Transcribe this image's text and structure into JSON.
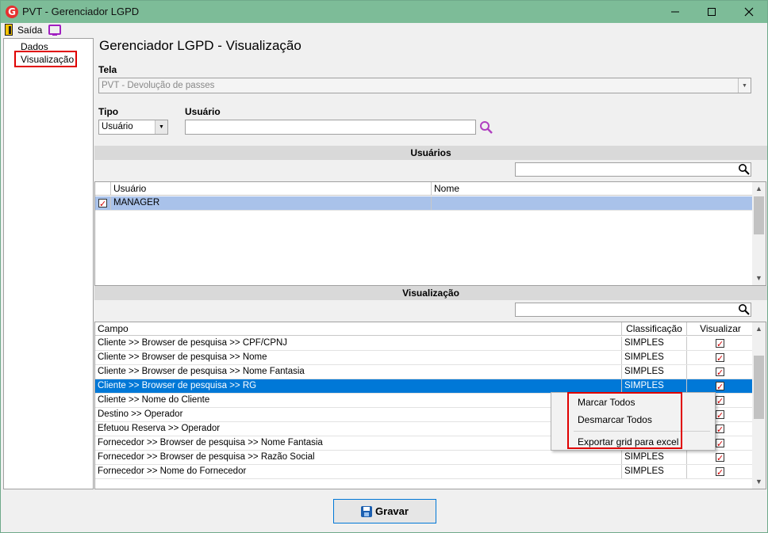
{
  "window": {
    "title": "PVT - Gerenciador LGPD",
    "app_icon_letter": "G"
  },
  "menu": {
    "exit_label": "Saída"
  },
  "tree": {
    "items": [
      {
        "label": "Dados"
      },
      {
        "label": "Visualização"
      }
    ]
  },
  "page": {
    "title": "Gerenciador LGPD - Visualização"
  },
  "form": {
    "tela_label": "Tela",
    "tela_value": "PVT - Devolução de passes",
    "tipo_label": "Tipo",
    "tipo_value": "Usuário",
    "usuario_label": "Usuário",
    "usuario_value": ""
  },
  "usuarios_section": {
    "title": "Usuários",
    "search_value": "",
    "columns": [
      "Usuário",
      "Nome"
    ],
    "rows": [
      {
        "checked": true,
        "usuario": "MANAGER",
        "nome": ""
      }
    ]
  },
  "visualizacao_section": {
    "title": "Visualização",
    "search_value": "",
    "columns": [
      "Campo",
      "Classificação",
      "Visualizar"
    ],
    "rows": [
      {
        "campo": "Cliente >> Browser de pesquisa >> CPF/CPNJ",
        "classificacao": "SIMPLES",
        "visualizar": true
      },
      {
        "campo": "Cliente >> Browser de pesquisa >> Nome",
        "classificacao": "SIMPLES",
        "visualizar": true
      },
      {
        "campo": "Cliente >> Browser de pesquisa >> Nome Fantasia",
        "classificacao": "SIMPLES",
        "visualizar": true
      },
      {
        "campo": "Cliente >> Browser de pesquisa >> RG",
        "classificacao": "SIMPLES",
        "visualizar": true,
        "selected": true
      },
      {
        "campo": "Cliente >> Nome do Cliente",
        "classificacao": "",
        "visualizar": true
      },
      {
        "campo": "Destino >> Operador",
        "classificacao": "",
        "visualizar": true
      },
      {
        "campo": "Efetuou Reserva >> Operador",
        "classificacao": "",
        "visualizar": true
      },
      {
        "campo": "Fornecedor >> Browser de pesquisa >> Nome Fantasia",
        "classificacao": "",
        "visualizar": true
      },
      {
        "campo": "Fornecedor >> Browser de pesquisa >> Razão Social",
        "classificacao": "SIMPLES",
        "visualizar": true
      },
      {
        "campo": "Fornecedor >> Nome do Fornecedor",
        "classificacao": "SIMPLES",
        "visualizar": true
      }
    ]
  },
  "context_menu": {
    "items": [
      "Marcar Todos",
      "Desmarcar Todos",
      "Exportar grid para excel"
    ]
  },
  "actions": {
    "save_label": "Gravar"
  },
  "colors": {
    "titlebar": "#7dbc98",
    "selection": "#0078d7",
    "annotation": "#e00000"
  }
}
